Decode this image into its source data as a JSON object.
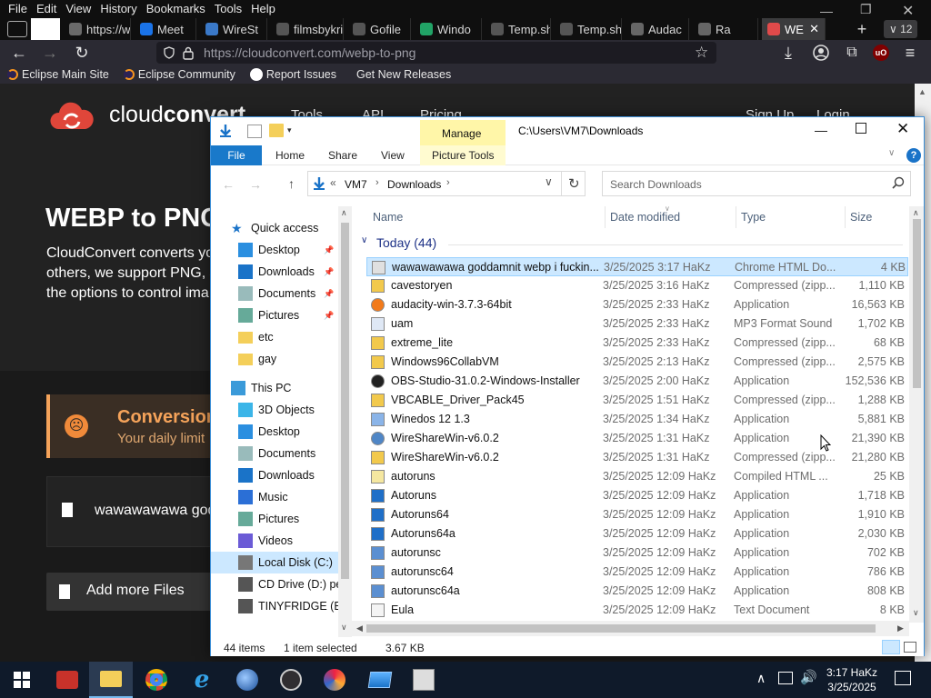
{
  "firefox": {
    "menu": [
      "File",
      "Edit",
      "View",
      "History",
      "Bookmarks",
      "Tools",
      "Help"
    ],
    "tabs": [
      {
        "title": "https://wo",
        "fav": "#6a6a6a"
      },
      {
        "title": "Meet",
        "fav": "#1a73e8"
      },
      {
        "title": "WireSt",
        "fav": "#3a79c8"
      },
      {
        "title": "filmsbykris",
        "fav": "#555"
      },
      {
        "title": "Gofile",
        "fav": "#555"
      },
      {
        "title": "Windo",
        "fav": "#21a366"
      },
      {
        "title": "Temp.sh | c",
        "fav": "#555"
      },
      {
        "title": "Temp.sh | c",
        "fav": "#555"
      },
      {
        "title": "Audac",
        "fav": "#666"
      },
      {
        "title": "Ra",
        "fav": "#666"
      },
      {
        "title": "WE",
        "fav": "#e04a4a"
      }
    ],
    "tab_overflow_count": "12",
    "url": "https://cloudconvert.com/webp-to-png",
    "bookmarks": [
      "Eclipse Main Site",
      "Eclipse Community",
      "Report Issues",
      "Get New Releases"
    ]
  },
  "page": {
    "logo": "cloudconvert",
    "logo_bold": "convert",
    "logo_light": "cloud",
    "nav": [
      "Tools",
      "API",
      "Pricing",
      "Sign Up",
      "Login"
    ],
    "hero_title": "WEBP to PNG",
    "hero_line1": "CloudConvert converts yo",
    "hero_line2": "others, we support PNG, J",
    "hero_line3": "the options to control ima",
    "alert_title": "Conversion",
    "alert_text": "Your daily limit",
    "file_name": "wawawawawa god",
    "add_files": "Add more Files"
  },
  "explorer": {
    "title_path": "C:\\Users\\VM7\\Downloads",
    "ribbon_tabs": [
      "File",
      "Home",
      "Share",
      "View",
      "Picture Tools"
    ],
    "manage_label": "Manage",
    "address": [
      "VM7",
      "Downloads"
    ],
    "search_placeholder": "Search Downloads",
    "columns": [
      "Name",
      "Date modified",
      "Type",
      "Size"
    ],
    "group_label": "Today (44)",
    "nav_items": [
      {
        "label": "Quick access",
        "icon": "star-icon",
        "pin": false
      },
      {
        "label": "Desktop",
        "icon": "desktop-icon",
        "pin": true
      },
      {
        "label": "Downloads",
        "icon": "download-icon",
        "pin": true
      },
      {
        "label": "Documents",
        "icon": "document-icon",
        "pin": true
      },
      {
        "label": "Pictures",
        "icon": "pictures-icon",
        "pin": true
      },
      {
        "label": "etc",
        "icon": "folder-icon",
        "pin": false
      },
      {
        "label": "gay",
        "icon": "folder-icon",
        "pin": false
      },
      {
        "label": "This PC",
        "icon": "pc-icon",
        "pin": false
      },
      {
        "label": "3D Objects",
        "icon": "cube-icon",
        "pin": false
      },
      {
        "label": "Desktop",
        "icon": "desktop-icon",
        "pin": false
      },
      {
        "label": "Documents",
        "icon": "document-icon",
        "pin": false
      },
      {
        "label": "Downloads",
        "icon": "download-icon",
        "pin": false
      },
      {
        "label": "Music",
        "icon": "music-icon",
        "pin": false
      },
      {
        "label": "Pictures",
        "icon": "pictures-icon",
        "pin": false
      },
      {
        "label": "Videos",
        "icon": "video-icon",
        "pin": false
      },
      {
        "label": "Local Disk (C:)",
        "icon": "disk-icon",
        "pin": false
      },
      {
        "label": "CD Drive (D:) per",
        "icon": "cd-icon",
        "pin": false
      },
      {
        "label": "TINYFRIDGE (E:)",
        "icon": "usb-icon",
        "pin": false
      }
    ],
    "files": [
      {
        "name": "wawawawawa goddamnit webp i fuckin...",
        "date": "3/25/2025 3:17 HaKz",
        "type": "Chrome HTML Do...",
        "size": "4 KB",
        "icon": "chrome-html-icon",
        "selected": true
      },
      {
        "name": "cavestoryen",
        "date": "3/25/2025 3:16 HaKz",
        "type": "Compressed (zipp...",
        "size": "1,110 KB",
        "icon": "zip-icon",
        "selected": false
      },
      {
        "name": "audacity-win-3.7.3-64bit",
        "date": "3/25/2025 2:33 HaKz",
        "type": "Application",
        "size": "16,563 KB",
        "icon": "audacity-icon",
        "selected": false
      },
      {
        "name": "uam",
        "date": "3/25/2025 2:33 HaKz",
        "type": "MP3 Format Sound",
        "size": "1,702 KB",
        "icon": "audio-file-icon",
        "selected": false
      },
      {
        "name": "extreme_lite",
        "date": "3/25/2025 2:33 HaKz",
        "type": "Compressed (zipp...",
        "size": "68 KB",
        "icon": "zip-icon",
        "selected": false
      },
      {
        "name": "Windows96CollabVM",
        "date": "3/25/2025 2:13 HaKz",
        "type": "Compressed (zipp...",
        "size": "2,575 KB",
        "icon": "zip-icon",
        "selected": false
      },
      {
        "name": "OBS-Studio-31.0.2-Windows-Installer",
        "date": "3/25/2025 2:00 HaKz",
        "type": "Application",
        "size": "152,536 KB",
        "icon": "obs-icon",
        "selected": false
      },
      {
        "name": "VBCABLE_Driver_Pack45",
        "date": "3/25/2025 1:51 HaKz",
        "type": "Compressed (zipp...",
        "size": "1,288 KB",
        "icon": "zip-icon",
        "selected": false
      },
      {
        "name": "Winedos 12 1.3",
        "date": "3/25/2025 1:34 HaKz",
        "type": "Application",
        "size": "5,881 KB",
        "icon": "app-icon",
        "selected": false
      },
      {
        "name": "WireShareWin-v6.0.2",
        "date": "3/25/2025 1:31 HaKz",
        "type": "Application",
        "size": "21,390 KB",
        "icon": "globe-icon",
        "selected": false
      },
      {
        "name": "WireShareWin-v6.0.2",
        "date": "3/25/2025 1:31 HaKz",
        "type": "Compressed (zipp...",
        "size": "21,280 KB",
        "icon": "zip-icon",
        "selected": false
      },
      {
        "name": "autoruns",
        "date": "3/25/2025 12:09 HaKz",
        "type": "Compiled HTML ...",
        "size": "25 KB",
        "icon": "help-file-icon",
        "selected": false
      },
      {
        "name": "Autoruns",
        "date": "3/25/2025 12:09 HaKz",
        "type": "Application",
        "size": "1,718 KB",
        "icon": "window-app-icon",
        "selected": false
      },
      {
        "name": "Autoruns64",
        "date": "3/25/2025 12:09 HaKz",
        "type": "Application",
        "size": "1,910 KB",
        "icon": "window-app-icon",
        "selected": false
      },
      {
        "name": "Autoruns64a",
        "date": "3/25/2025 12:09 HaKz",
        "type": "Application",
        "size": "2,030 KB",
        "icon": "window-app-icon",
        "selected": false
      },
      {
        "name": "autorunsc",
        "date": "3/25/2025 12:09 HaKz",
        "type": "Application",
        "size": "702 KB",
        "icon": "console-app-icon",
        "selected": false
      },
      {
        "name": "autorunsc64",
        "date": "3/25/2025 12:09 HaKz",
        "type": "Application",
        "size": "786 KB",
        "icon": "console-app-icon",
        "selected": false
      },
      {
        "name": "autorunsc64a",
        "date": "3/25/2025 12:09 HaKz",
        "type": "Application",
        "size": "808 KB",
        "icon": "console-app-icon",
        "selected": false
      },
      {
        "name": "Eula",
        "date": "3/25/2025 12:09 HaKz",
        "type": "Text Document",
        "size": "8 KB",
        "icon": "text-file-icon",
        "selected": false
      }
    ],
    "status_count": "44 items",
    "status_selected": "1 item selected",
    "status_size": "3.67 KB"
  },
  "taskbar": {
    "time": "3:17 HaKz",
    "date": "3/25/2025"
  },
  "colors": {
    "accent": "#0078d7",
    "ff_dark": "#0f0f0f",
    "page_bg": "#242424",
    "brand_red": "#e0463a"
  }
}
